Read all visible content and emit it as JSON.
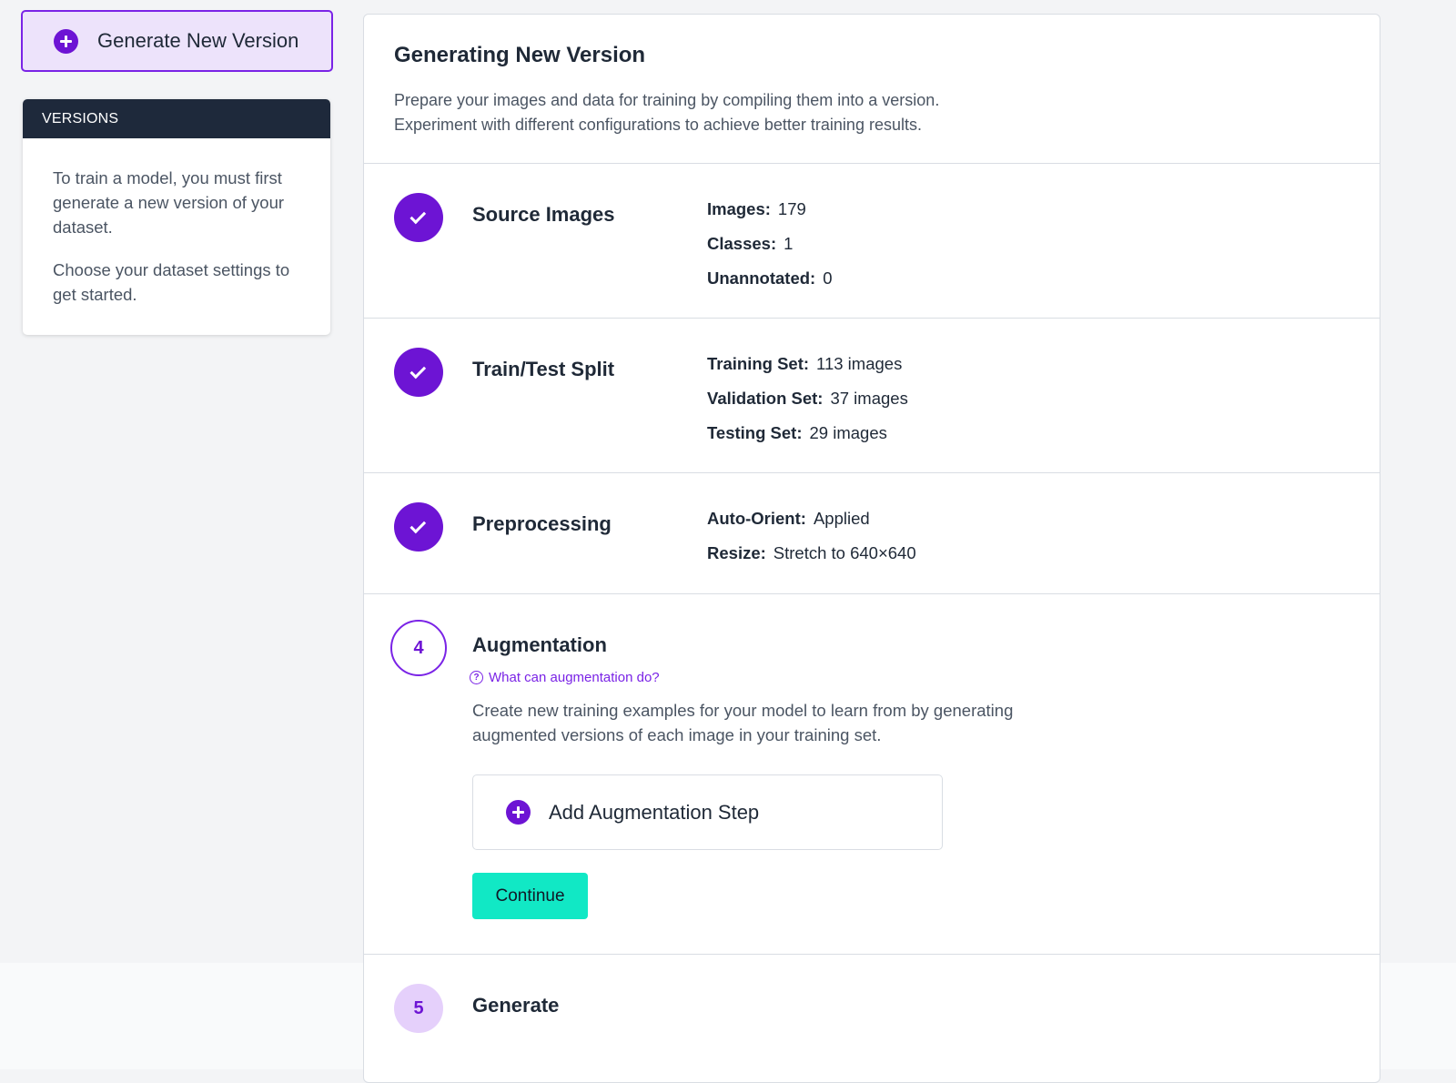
{
  "sidebar": {
    "generate_button_label": "Generate New Version",
    "versions_header": "VERSIONS",
    "versions_text_1": "To train a model, you must first generate a new version of your dataset.",
    "versions_text_2": "Choose your dataset settings to get started."
  },
  "main": {
    "title": "Generating New Version",
    "description_line1": "Prepare your images and data for training by compiling them into a version.",
    "description_line2": "Experiment with different configurations to achieve better training results."
  },
  "steps": {
    "source": {
      "title": "Source Images",
      "rows": [
        {
          "label": "Images:",
          "value": "179"
        },
        {
          "label": "Classes:",
          "value": "1"
        },
        {
          "label": "Unannotated:",
          "value": "0"
        }
      ]
    },
    "split": {
      "title": "Train/Test Split",
      "rows": [
        {
          "label": "Training Set:",
          "value": "113 images"
        },
        {
          "label": "Validation Set:",
          "value": "37 images"
        },
        {
          "label": "Testing Set:",
          "value": "29 images"
        }
      ]
    },
    "preprocessing": {
      "title": "Preprocessing",
      "rows": [
        {
          "label": "Auto-Orient:",
          "value": "Applied"
        },
        {
          "label": "Resize:",
          "value": "Stretch to 640×640"
        }
      ]
    },
    "augmentation": {
      "number": "4",
      "title": "Augmentation",
      "help_link": "What can augmentation do?",
      "help_icon_glyph": "?",
      "description_line1": "Create new training examples for your model to learn from by generating",
      "description_line2": "augmented versions of each image in your training set.",
      "add_button_label": "Add Augmentation Step",
      "continue_label": "Continue"
    },
    "generate": {
      "number": "5",
      "title": "Generate"
    }
  },
  "colors": {
    "brand_purple": "#6d14d4",
    "accent_teal": "#11e8c5",
    "dark_header": "#1e293b"
  }
}
